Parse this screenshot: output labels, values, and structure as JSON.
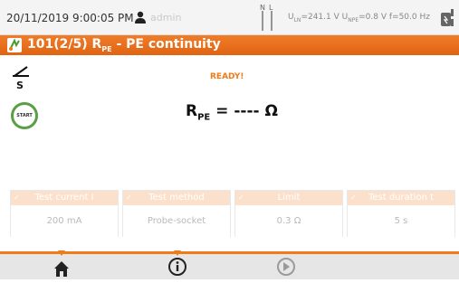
{
  "status": {
    "datetime": "20/11/2019 9:00:05 PM",
    "user": "admin",
    "n_label": "N",
    "l_label": "L",
    "measurements": "U_LN=241.1 V U_NPE=0.8 V f=50.0 Hz",
    "uln": "U",
    "uln_sub": "LN",
    "uln_val": "=241.1 V",
    "unpe": "U",
    "unpe_sub": "NPE",
    "unpe_val": "=0.8 V f=50.0 Hz"
  },
  "title": {
    "prefix": "101(2/5) R",
    "sub": "PE",
    "suffix": " - PE continuity"
  },
  "main": {
    "status": "READY!",
    "start_label": "START",
    "result_symbol": "R",
    "result_sub": "PE",
    "result_value": " = ---- Ω"
  },
  "params": [
    {
      "label": "Test current I",
      "value": "200 mA"
    },
    {
      "label": "Test method",
      "value": "Probe-socket"
    },
    {
      "label": "Limit",
      "value": "0.3 Ω"
    },
    {
      "label": "Test duration t",
      "value": "5 s"
    }
  ],
  "nav": {
    "icons": [
      "home-icon",
      "info-icon",
      "next-icon"
    ]
  },
  "colors": {
    "accent": "#f07b18",
    "start_ring": "#5a9e45",
    "param_header": "#fbe1cb"
  }
}
